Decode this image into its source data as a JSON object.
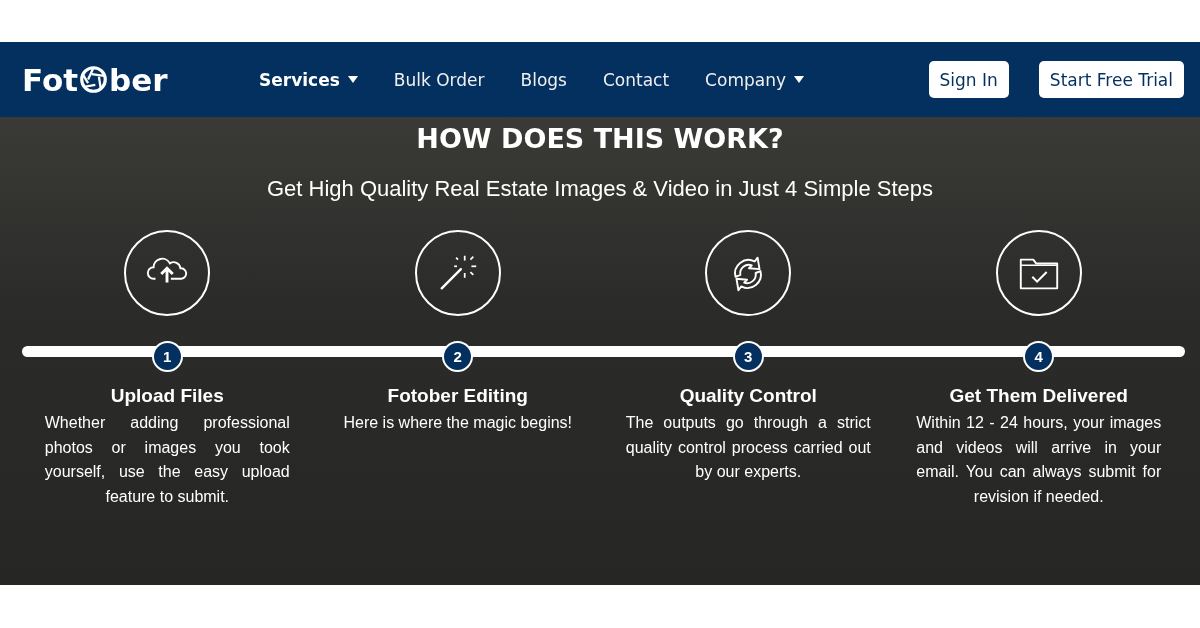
{
  "logo": {
    "left": "Fot",
    "right": "ber"
  },
  "nav": [
    {
      "label": "Services",
      "selected": true,
      "dropdown": true
    },
    {
      "label": "Bulk Order",
      "selected": false,
      "dropdown": false
    },
    {
      "label": "Blogs",
      "selected": false,
      "dropdown": false
    },
    {
      "label": "Contact",
      "selected": false,
      "dropdown": false
    },
    {
      "label": "Company",
      "selected": false,
      "dropdown": true
    }
  ],
  "actions": [
    {
      "label": "Sign In"
    },
    {
      "label": "Start Free Trial"
    }
  ],
  "hero": {
    "title": "HOW DOES THIS WORK?",
    "subtitle": "Get High Quality Real Estate Images & Video in Just 4 Simple Steps"
  },
  "steps": [
    {
      "kind": "upload",
      "number": "1",
      "title": "Upload Files",
      "text": "Whether adding professional photos or images you took yourself, use the easy upload feature to submit."
    },
    {
      "kind": "wand",
      "number": "2",
      "title": "Fotober Editing",
      "text": "Here is where the magic begins!"
    },
    {
      "kind": "refresh",
      "number": "3",
      "title": "Quality Control",
      "text": "The outputs go through a strict quality control process carried out by our experts."
    },
    {
      "kind": "folder",
      "number": "4",
      "title": "Get Them Delivered",
      "text": "Within 12 - 24 hours, your images and videos will arrive in your email. You can always submit for revision if needed."
    }
  ]
}
